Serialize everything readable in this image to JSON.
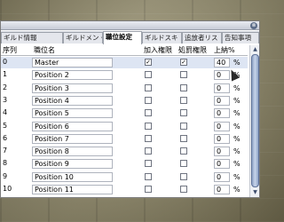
{
  "window": {
    "close_symbol": "⊗"
  },
  "tabs": [
    "ギルド情報",
    "ギルドメン・",
    "職位設定",
    "ギルドスキ",
    "追放者リス",
    "告知事項"
  ],
  "active_tab": 2,
  "columns": {
    "index": "序列",
    "name": "職位名",
    "join": "加入権限",
    "expel": "処罰権限",
    "tax": "上納%"
  },
  "rows": [
    {
      "index": "0",
      "name": "Master",
      "join": true,
      "expel": true,
      "tax": "40",
      "pct": "%"
    },
    {
      "index": "1",
      "name": "Position 2",
      "join": false,
      "expel": false,
      "tax": "0",
      "pct": "%"
    },
    {
      "index": "2",
      "name": "Position 3",
      "join": false,
      "expel": false,
      "tax": "0",
      "pct": "%"
    },
    {
      "index": "3",
      "name": "Position 4",
      "join": false,
      "expel": false,
      "tax": "0",
      "pct": "%"
    },
    {
      "index": "4",
      "name": "Position 5",
      "join": false,
      "expel": false,
      "tax": "0",
      "pct": "%"
    },
    {
      "index": "5",
      "name": "Position 6",
      "join": false,
      "expel": false,
      "tax": "0",
      "pct": "%"
    },
    {
      "index": "6",
      "name": "Position 7",
      "join": false,
      "expel": false,
      "tax": "0",
      "pct": "%"
    },
    {
      "index": "7",
      "name": "Position 8",
      "join": false,
      "expel": false,
      "tax": "0",
      "pct": "%"
    },
    {
      "index": "8",
      "name": "Position 9",
      "join": false,
      "expel": false,
      "tax": "0",
      "pct": "%"
    },
    {
      "index": "9",
      "name": "Position 10",
      "join": false,
      "expel": false,
      "tax": "0",
      "pct": "%"
    },
    {
      "index": "10",
      "name": "Position 11",
      "join": false,
      "expel": false,
      "tax": "0",
      "pct": "%"
    }
  ],
  "selected_row": 0,
  "check_symbol": "✓"
}
